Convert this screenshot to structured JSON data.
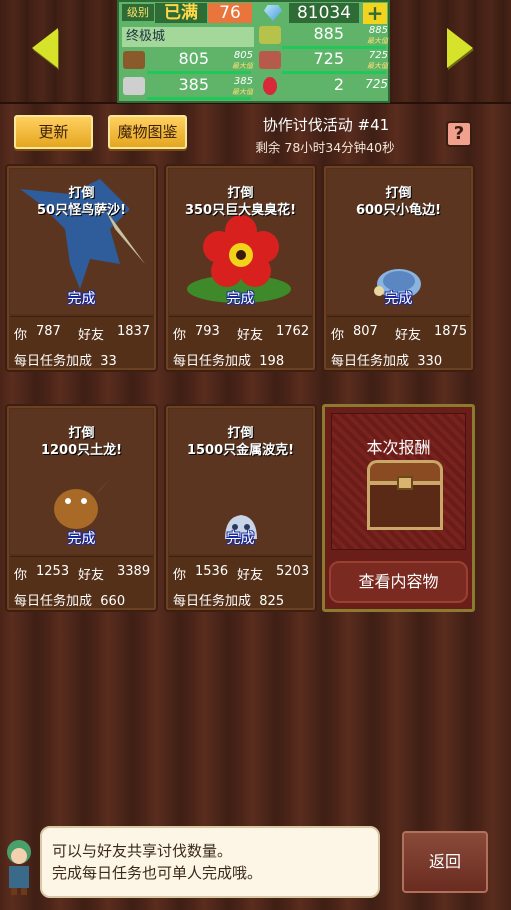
{
  "header": {
    "level_label": "级别",
    "level_value": "已满",
    "level_number": "76",
    "gems": "81034",
    "add_gems_label": "+",
    "city_name": "终极城",
    "max_label": "最大值",
    "resources": [
      {
        "icon": "wood-icon",
        "value": "805",
        "max": "805",
        "color": "#8a5a2a"
      },
      {
        "icon": "stone-icon",
        "value": "385",
        "max": "385",
        "color": "#cfcfcf"
      },
      {
        "icon": "crop-icon",
        "value": "885",
        "max": "885",
        "color": "#b7c24a"
      },
      {
        "icon": "food-icon",
        "value": "725",
        "max": "725",
        "color": "#b85a4a"
      },
      {
        "icon": "red-gem-icon",
        "value": "2",
        "max": "725",
        "color": "#d8283a"
      }
    ]
  },
  "toolbar": {
    "refresh_label": "更新",
    "monster_book_label": "魔物图鉴",
    "event_title": "协作讨伐活动 #41",
    "remaining_time": "剩余 78小时34分钟40秒",
    "help_label": "?"
  },
  "labels": {
    "you": "你",
    "friends": "好友",
    "daily_bonus": "每日任务加成",
    "complete": "完成",
    "defeat": "打倒"
  },
  "quests": [
    {
      "target": "50只怪鸟萨沙!",
      "you": "787",
      "friends": "1837",
      "bonus": "33",
      "monster": "bird-monster-icon"
    },
    {
      "target": "350只巨大臭臭花!",
      "you": "793",
      "friends": "1762",
      "bonus": "198",
      "monster": "rafflesia-monster-icon"
    },
    {
      "target": "600只小龟边!",
      "you": "807",
      "friends": "1875",
      "bonus": "330",
      "monster": "turtle-monster-icon"
    },
    {
      "target": "1200只土龙!",
      "you": "1253",
      "friends": "3389",
      "bonus": "660",
      "monster": "dragon-monster-icon"
    },
    {
      "target": "1500只金属波克!",
      "you": "1536",
      "friends": "5203",
      "bonus": "825",
      "monster": "metal-slime-monster-icon"
    }
  ],
  "reward": {
    "title": "本次报酬",
    "view_contents_label": "查看内容物"
  },
  "footer": {
    "hint_line1": "可以与好友共享讨伐数量。",
    "hint_line2": "完成每日任务也可单人完成哦。",
    "back_label": "返回"
  },
  "colors": {
    "accent_gold": "#f2c444",
    "done_blue": "#1a2a9a",
    "stat_green": "#5fb46a"
  }
}
